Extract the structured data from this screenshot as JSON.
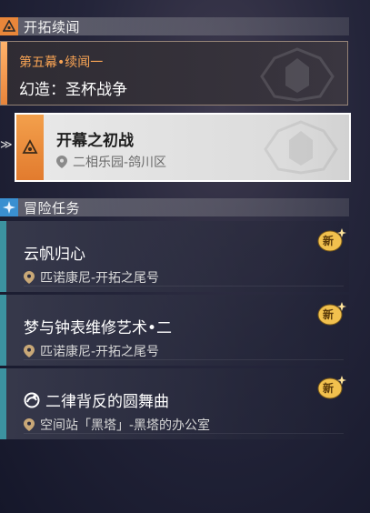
{
  "sections": {
    "continuance": {
      "title": "开拓续闻"
    },
    "adventure": {
      "title": "冒险任务"
    }
  },
  "active_card": {
    "subtitle": "第五幕•续闻一",
    "title": "幻造：圣杯战争"
  },
  "selected_card": {
    "title": "开幕之初战",
    "location": "二相乐园-鸽川区"
  },
  "missions": [
    {
      "title": "云帆归心",
      "location": "匹诺康尼-开拓之尾号",
      "badge": "新",
      "has_icon": false
    },
    {
      "title": "梦与钟表维修艺术•二",
      "location": "匹诺康尼-开拓之尾号",
      "badge": "新",
      "has_icon": false
    },
    {
      "title": "二律背反的圆舞曲",
      "location": "空间站「黑塔」-黑塔的办公室",
      "badge": "新",
      "has_icon": true
    }
  ],
  "colors": {
    "accent_orange": "#f7a354",
    "mission_stripe": "#3c93a0",
    "badge_gold": "#f2c14e"
  }
}
